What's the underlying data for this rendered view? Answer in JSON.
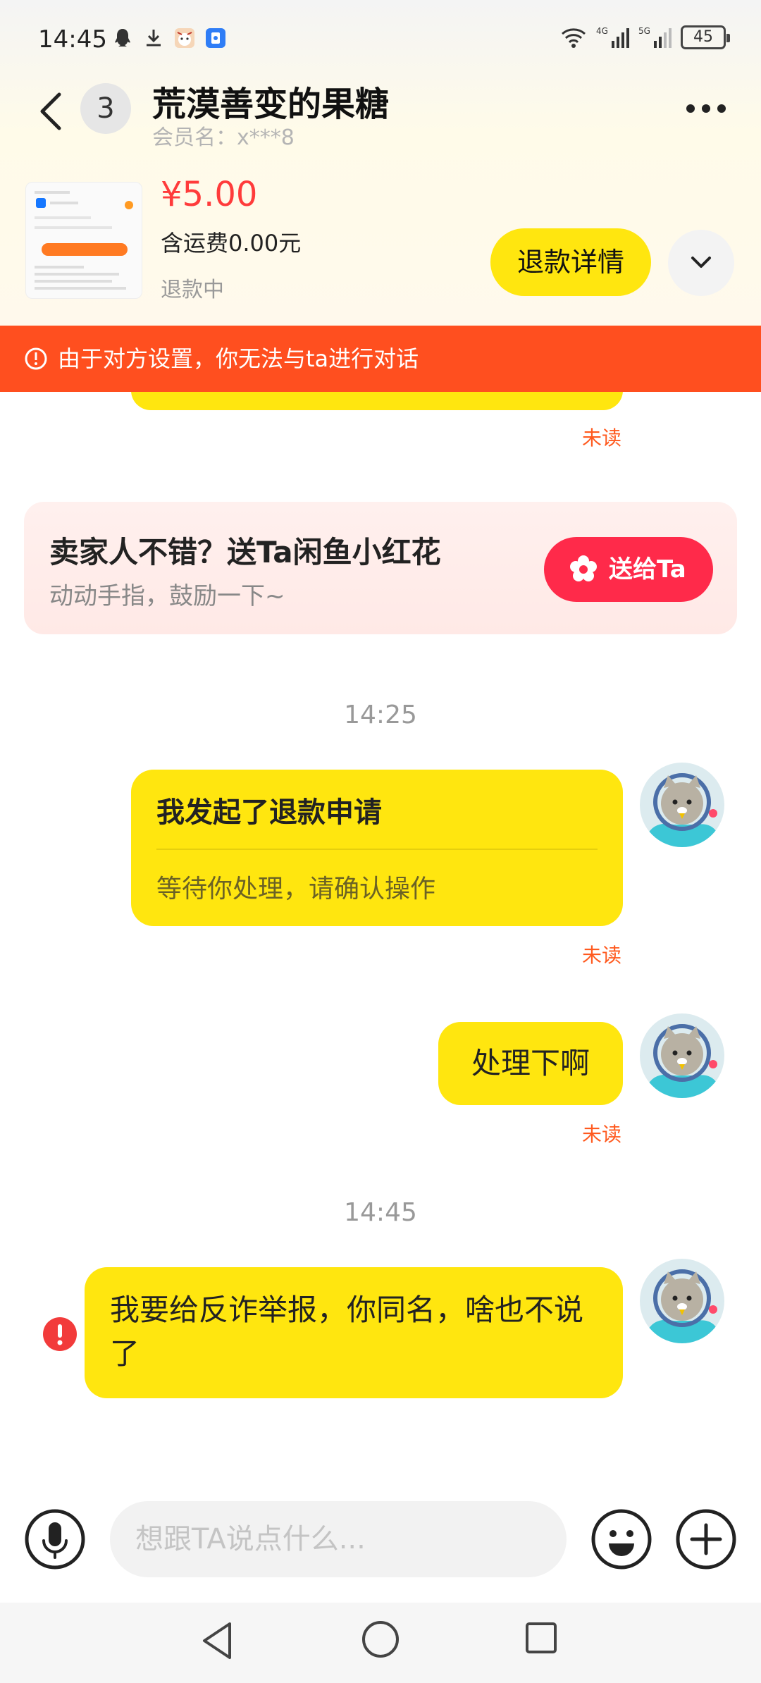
{
  "status_bar": {
    "time": "14:45",
    "signal_left": "4G",
    "signal_right": "5G",
    "battery": "45"
  },
  "header": {
    "unread_count": "3",
    "title": "荒漠善变的果糖",
    "member_label": "会员名：x***8"
  },
  "order": {
    "price": "¥5.00",
    "shipping": "含运费0.00元",
    "status": "退款中",
    "refund_detail_label": "退款详情"
  },
  "warning": {
    "text": "由于对方设置，你无法与ta进行对话"
  },
  "chat": {
    "unread_label": "未读",
    "promo": {
      "title": "卖家人不错？送Ta闲鱼小红花",
      "subtitle": "动动手指，鼓励一下~",
      "button_label": "送给Ta"
    },
    "timestamp_1": "14:25",
    "refund_card": {
      "title": "我发起了退款申请",
      "subtitle": "等待你处理，请确认操作"
    },
    "message_2": "处理下啊",
    "timestamp_2": "14:45",
    "message_3": "我要给反诈举报，你同名，啥也不说了"
  },
  "input": {
    "placeholder": "想跟TA说点什么..."
  },
  "colors": {
    "accent_yellow": "#ffe60f",
    "warning_orange": "#ff4f1f",
    "price_red": "#ff3b3b",
    "promo_red": "#ff2a4a",
    "unread_orange": "#ff5a1f"
  }
}
